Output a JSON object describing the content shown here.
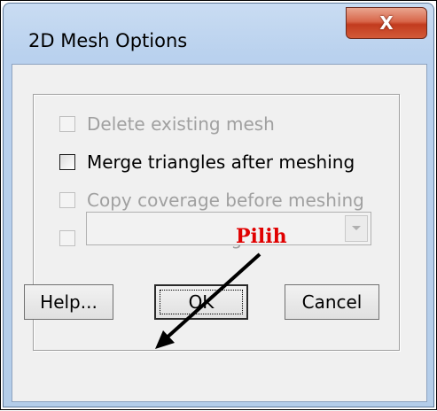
{
  "window": {
    "title": "2D Mesh Options",
    "close_glyph": "X"
  },
  "options": [
    {
      "label": "Delete existing mesh",
      "enabled": false,
      "checked": false
    },
    {
      "label": "Merge triangles after meshing",
      "enabled": true,
      "checked": false
    },
    {
      "label": "Copy coverage before meshing",
      "enabled": false,
      "checked": false
    },
    {
      "label": "Use area coverage",
      "enabled": false,
      "checked": false
    }
  ],
  "dropdown": {
    "value": "",
    "enabled": false
  },
  "buttons": {
    "help": "Help...",
    "ok": "OK",
    "cancel": "Cancel"
  },
  "annotation": {
    "text": "Pilih",
    "color": "#e00000"
  },
  "icons": {
    "close": "close-icon",
    "dropdown": "chevron-down-icon",
    "annotation_arrow": "arrow-icon"
  }
}
